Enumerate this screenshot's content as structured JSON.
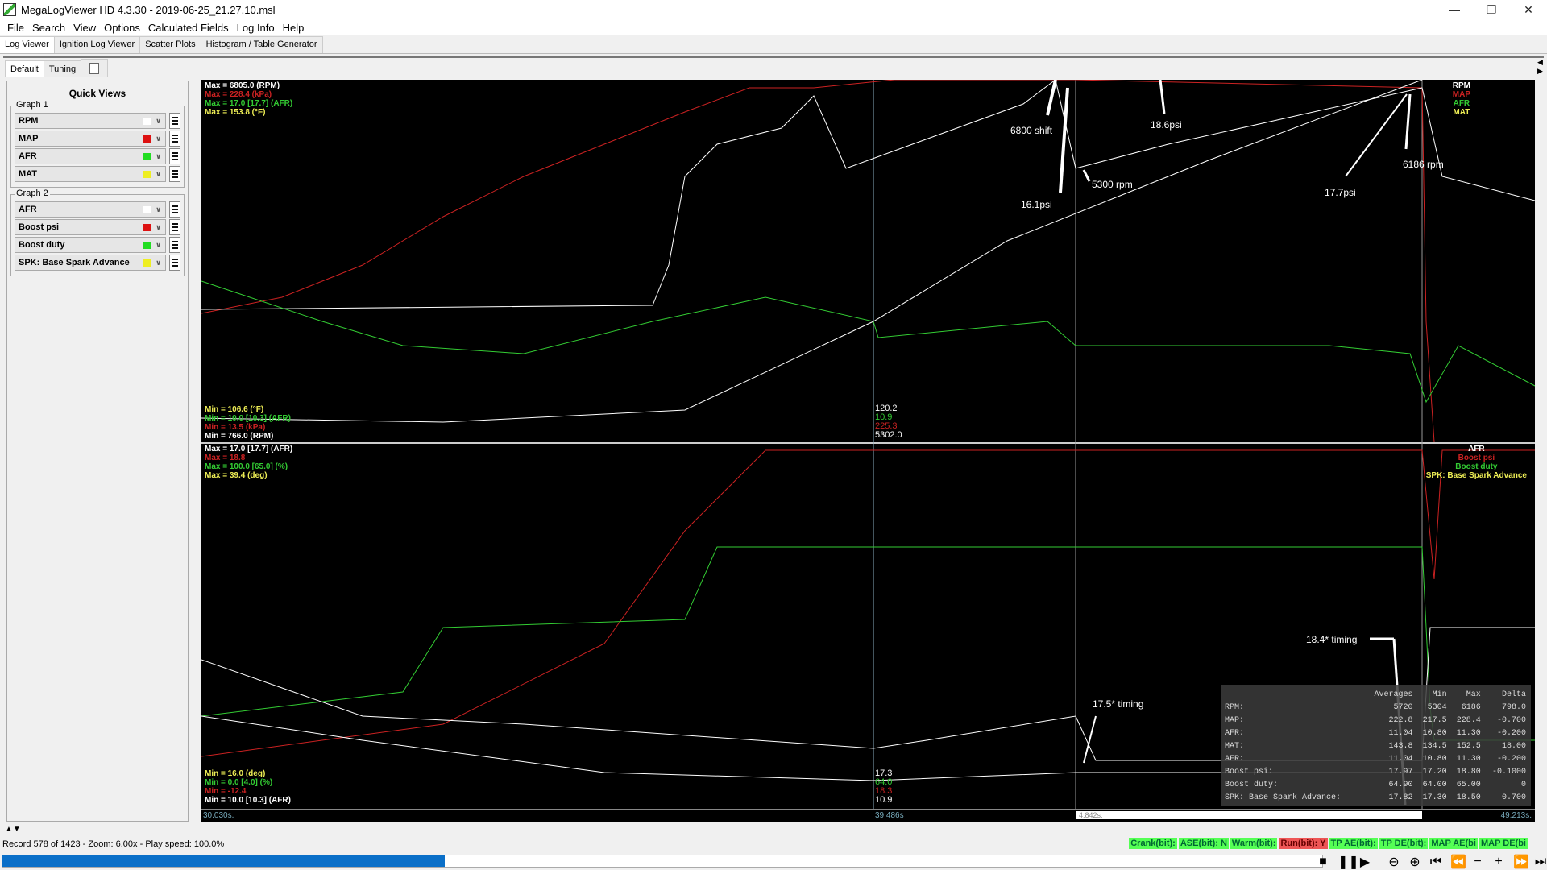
{
  "window": {
    "title": "MegaLogViewer HD 4.3.30 - 2019-06-25_21.27.10.msl",
    "controls": [
      "minimize",
      "restore",
      "close"
    ]
  },
  "menu": [
    "File",
    "Search",
    "View",
    "Options",
    "Calculated Fields",
    "Log Info",
    "Help"
  ],
  "main_tabs": [
    {
      "label": "Log Viewer",
      "active": true
    },
    {
      "label": "Ignition Log Viewer",
      "active": false
    },
    {
      "label": "Scatter Plots",
      "active": false
    },
    {
      "label": "Histogram / Table Generator",
      "active": false
    }
  ],
  "sub_tabs": [
    {
      "label": "Default",
      "active": true
    },
    {
      "label": "Tuning",
      "active": false
    }
  ],
  "quick_views": {
    "title": "Quick Views",
    "groups": [
      {
        "label": "Graph 1",
        "fields": [
          {
            "name": "RPM",
            "color": "#ffffff"
          },
          {
            "name": "MAP",
            "color": "#dd1111"
          },
          {
            "name": "AFR",
            "color": "#22dd22"
          },
          {
            "name": "MAT",
            "color": "#eeee22"
          }
        ]
      },
      {
        "label": "Graph 2",
        "fields": [
          {
            "name": "AFR",
            "color": "#ffffff"
          },
          {
            "name": "Boost psi",
            "color": "#dd1111"
          },
          {
            "name": "Boost duty",
            "color": "#22dd22"
          },
          {
            "name": "SPK: Base Spark Advance",
            "color": "#eeee22"
          }
        ]
      }
    ]
  },
  "graph1": {
    "max_labels": [
      {
        "text": "Max = 6805.0 (RPM)",
        "color": "#ffffff"
      },
      {
        "text": "Max = 228.4 (kPa)",
        "color": "#cc2222"
      },
      {
        "text": "Max = 17.0 [17.7] (AFR)",
        "color": "#33cc33"
      },
      {
        "text": "Max = 153.8 (°F)",
        "color": "#eeee55"
      }
    ],
    "min_labels": [
      {
        "text": "Min = 106.6 (°F)",
        "color": "#eeee55"
      },
      {
        "text": "Min = 10.0 [10.3] (AFR)",
        "color": "#33cc33"
      },
      {
        "text": "Min = 13.5 (kPa)",
        "color": "#cc2222"
      },
      {
        "text": "Min = 766.0 (RPM)",
        "color": "#ffffff"
      }
    ],
    "legend": [
      {
        "text": "RPM",
        "color": "#ffffff"
      },
      {
        "text": "MAP",
        "color": "#cc2222"
      },
      {
        "text": "AFR",
        "color": "#33cc33"
      },
      {
        "text": "MAT",
        "color": "#eeee55"
      }
    ],
    "cursor_values": [
      {
        "text": "120.2",
        "color": "#ffffff"
      },
      {
        "text": "10.9",
        "color": "#33cc33"
      },
      {
        "text": "225.3",
        "color": "#cc2222"
      },
      {
        "text": "5302.0",
        "color": "#ffffff"
      }
    ]
  },
  "graph2": {
    "max_labels": [
      {
        "text": "Max = 17.0 [17.7] (AFR)",
        "color": "#ffffff"
      },
      {
        "text": "Max = 18.8",
        "color": "#cc2222"
      },
      {
        "text": "Max = 100.0 [65.0] (%)",
        "color": "#33cc33"
      },
      {
        "text": "Max = 39.4 (deg)",
        "color": "#eeee55"
      }
    ],
    "min_labels": [
      {
        "text": "Min = 16.0 (deg)",
        "color": "#eeee55"
      },
      {
        "text": "Min = 0.0 [4.0] (%)",
        "color": "#33cc33"
      },
      {
        "text": "Min = -12.4",
        "color": "#cc2222"
      },
      {
        "text": "Min = 10.0 [10.3] (AFR)",
        "color": "#ffffff"
      }
    ],
    "legend": [
      {
        "text": "AFR",
        "color": "#ffffff"
      },
      {
        "text": "Boost psi",
        "color": "#cc2222"
      },
      {
        "text": "Boost duty",
        "color": "#33cc33"
      },
      {
        "text": "SPK: Base Spark Advance",
        "color": "#eeee55"
      }
    ],
    "cursor_values": [
      {
        "text": "17.3",
        "color": "#ffffff"
      },
      {
        "text": "64.0",
        "color": "#33cc33"
      },
      {
        "text": "18.3",
        "color": "#cc2222"
      },
      {
        "text": "10.9",
        "color": "#ffffff"
      }
    ]
  },
  "annotations": [
    {
      "text": "6800 shift"
    },
    {
      "text": "18.6psi"
    },
    {
      "text": "16.1psi"
    },
    {
      "text": "5300 rpm"
    },
    {
      "text": "17.7psi"
    },
    {
      "text": "6186 rpm"
    },
    {
      "text": "18.4* timing"
    },
    {
      "text": "17.5* timing"
    }
  ],
  "averages": {
    "headers": [
      "",
      "Averages",
      "Min",
      "Max",
      "Delta"
    ],
    "rows": [
      [
        "RPM:",
        "5720",
        "5304",
        "6186",
        "798.0"
      ],
      [
        "MAP:",
        "222.8",
        "217.5",
        "228.4",
        "-0.700"
      ],
      [
        "AFR:",
        "11.04",
        "10.80",
        "11.30",
        "-0.200"
      ],
      [
        "MAT:",
        "143.8",
        "134.5",
        "152.5",
        "18.00"
      ],
      [
        "AFR:",
        "11.04",
        "10.80",
        "11.30",
        "-0.200"
      ],
      [
        "Boost psi:",
        "17.97",
        "17.20",
        "18.80",
        "-0.1000"
      ],
      [
        "Boost duty:",
        "64.90",
        "64.00",
        "65.00",
        "0"
      ],
      [
        "SPK: Base Spark Advance:",
        "17.82",
        "17.30",
        "18.50",
        "0.700"
      ]
    ]
  },
  "timeline": {
    "start": "30.030s.",
    "cursor": "39.486s",
    "selection": "4.842s.",
    "end": "49.213s."
  },
  "status": {
    "text": "Record 578 of 1423 - Zoom: 6.00x - Play speed: 100.0%",
    "progress": 0.335
  },
  "bits": [
    {
      "label": "Crank(bit):",
      "on": false
    },
    {
      "label": "ASE(bit): N",
      "on": false
    },
    {
      "label": "Warm(bit):",
      "on": false
    },
    {
      "label": "Run(bit): Y",
      "on": true
    },
    {
      "label": "TP AE(bit):",
      "on": false
    },
    {
      "label": "TP DE(bit):",
      "on": false
    },
    {
      "label": "MAP AE(bi",
      "on": false
    },
    {
      "label": "MAP DE(bi",
      "on": false
    }
  ],
  "play_controls": [
    "stop",
    "pause",
    "play",
    "zoom-out",
    "zoom-in",
    "skip-start",
    "rewind",
    "slower",
    "faster",
    "fast-forward",
    "skip-end"
  ]
}
